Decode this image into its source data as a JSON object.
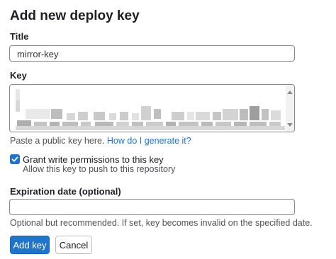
{
  "form": {
    "heading": "Add new deploy key",
    "title": {
      "label": "Title",
      "value": "mirror-key"
    },
    "key": {
      "label": "Key",
      "help_text": "Paste a public key here.",
      "help_link": "How do I generate it?"
    },
    "write_access": {
      "label": "Grant write permissions to this key",
      "help": "Allow this key to push to this repository",
      "checked": true
    },
    "expiration": {
      "label": "Expiration date (optional)",
      "value": "",
      "help": "Optional but recommended. If set, key becomes invalid on the specified date."
    },
    "buttons": {
      "submit": "Add key",
      "cancel": "Cancel"
    }
  },
  "colors": {
    "accent": "#1f75cb",
    "border": "#89888d"
  },
  "icons": {
    "checkbox": "check-icon",
    "scroll_up": "arrow-up-icon",
    "scroll_down": "arrow-down-icon"
  }
}
